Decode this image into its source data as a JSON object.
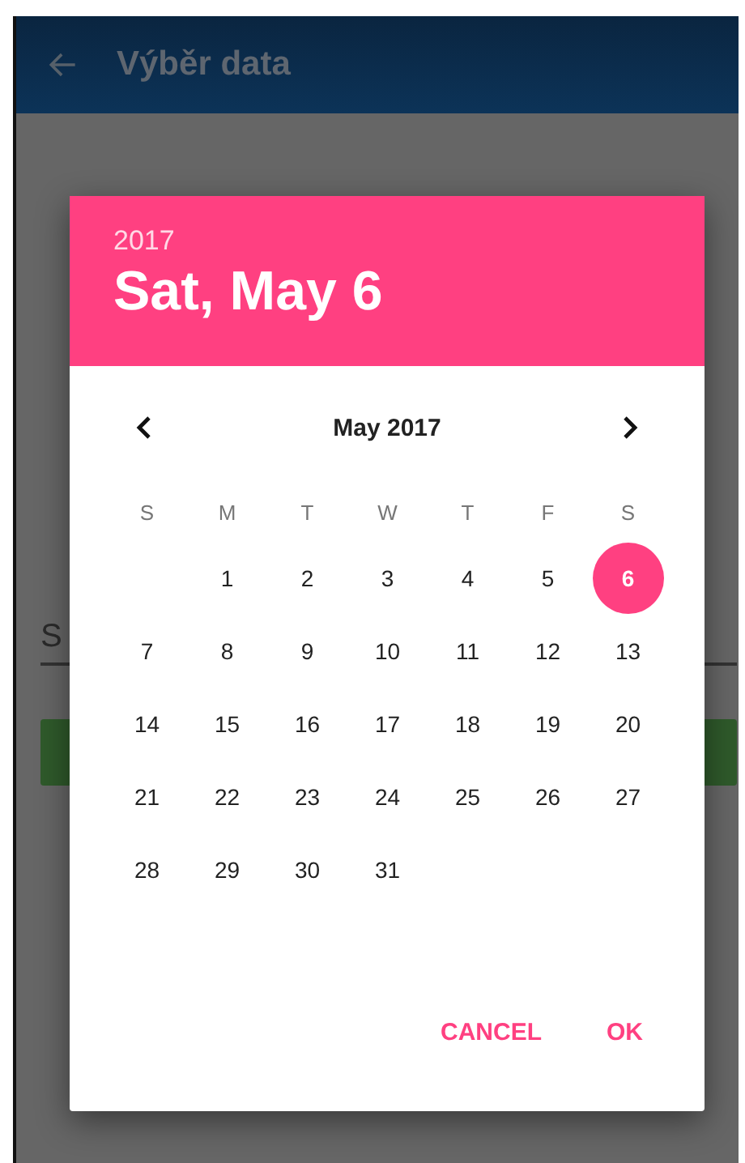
{
  "app_bar": {
    "title": "Výběr data"
  },
  "form": {
    "field_value": "S"
  },
  "dialog": {
    "header": {
      "year": "2017",
      "date": "Sat, May 6"
    },
    "month_title": "May 2017",
    "weekdays": [
      "S",
      "M",
      "T",
      "W",
      "T",
      "F",
      "S"
    ],
    "weeks": [
      [
        {
          "label": "1",
          "selected": false
        },
        {
          "label": "2",
          "selected": false
        },
        {
          "label": "3",
          "selected": false
        },
        {
          "label": "4",
          "selected": false
        },
        {
          "label": "5",
          "selected": false
        },
        {
          "label": "6",
          "selected": true
        }
      ],
      [
        {
          "label": "7",
          "selected": false
        },
        {
          "label": "8",
          "selected": false
        },
        {
          "label": "9",
          "selected": false
        },
        {
          "label": "10",
          "selected": false
        },
        {
          "label": "11",
          "selected": false
        },
        {
          "label": "12",
          "selected": false
        },
        {
          "label": "13",
          "selected": false
        }
      ],
      [
        {
          "label": "14",
          "selected": false
        },
        {
          "label": "15",
          "selected": false
        },
        {
          "label": "16",
          "selected": false
        },
        {
          "label": "17",
          "selected": false
        },
        {
          "label": "18",
          "selected": false
        },
        {
          "label": "19",
          "selected": false
        },
        {
          "label": "20",
          "selected": false
        }
      ],
      [
        {
          "label": "21",
          "selected": false
        },
        {
          "label": "22",
          "selected": false
        },
        {
          "label": "23",
          "selected": false
        },
        {
          "label": "24",
          "selected": false
        },
        {
          "label": "25",
          "selected": false
        },
        {
          "label": "26",
          "selected": false
        },
        {
          "label": "27",
          "selected": false
        }
      ],
      [
        {
          "label": "28",
          "selected": false
        },
        {
          "label": "29",
          "selected": false
        },
        {
          "label": "30",
          "selected": false
        },
        {
          "label": "31",
          "selected": false
        }
      ]
    ],
    "buttons": [
      {
        "label": "CANCEL"
      },
      {
        "label": "OK"
      }
    ]
  }
}
